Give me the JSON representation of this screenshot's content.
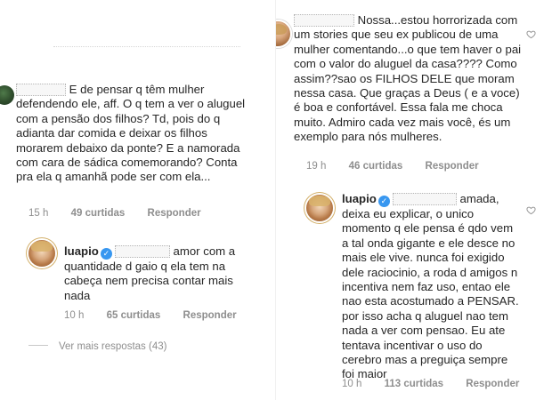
{
  "left": {
    "comment1": {
      "text": "E de pensar q têm mulher defendendo ele, aff. O q tem a ver o aluguel com a pensão dos filhos? Td, pois do q adianta dar comida e deixar os filhos morarem debaixo da ponte? E a namorada com cara de sádica comemorando? Conta pra ela q amanhã pode ser com ela...",
      "time": "15 h",
      "likes": "49 curtidas",
      "reply": "Responder"
    },
    "reply1": {
      "username": "luapio",
      "text": "amor com a quantidade d gaio q ela tem na cabeça nem precisa contar mais nada",
      "time": "10 h",
      "likes": "65 curtidas",
      "reply": "Responder"
    },
    "more_replies": "Ver mais respostas (43)"
  },
  "right": {
    "comment1": {
      "text": "Nossa...estou horrorizada com um stories que seu ex publicou de uma mulher comentando...o que tem haver o pai com o valor do aluguel da casa???? Como assim??sao os FILHOS DELE que moram nessa casa. Que graças a Deus ( e a voce) é boa e confortável. Essa fala me choca muito. Admiro cada vez mais você, és um exemplo para nós mulheres.",
      "time": "19 h",
      "likes": "46 curtidas",
      "reply": "Responder"
    },
    "reply1": {
      "username": "luapio",
      "text": "amada, deixa eu explicar, o unico momento q ele pensa é qdo vem a tal onda gigante e ele desce no mais ele vive. nunca foi exigido dele raciocinio, a roda d amigos n incentiva nem faz uso, entao ele nao esta acostumado a PENSAR. por isso acha q aluguel nao tem nada a ver com pensao. Eu ate tentava incentivar o uso do cerebro mas a preguiça sempre foi maior",
      "time": "10 h",
      "likes": "113 curtidas",
      "reply": "Responder"
    }
  },
  "colors": {
    "verified": "#3897f0",
    "meta": "#8e8e8e",
    "text": "#262626"
  },
  "icons": {
    "like": "heart-outline-icon",
    "verified": "verified-badge-icon"
  }
}
